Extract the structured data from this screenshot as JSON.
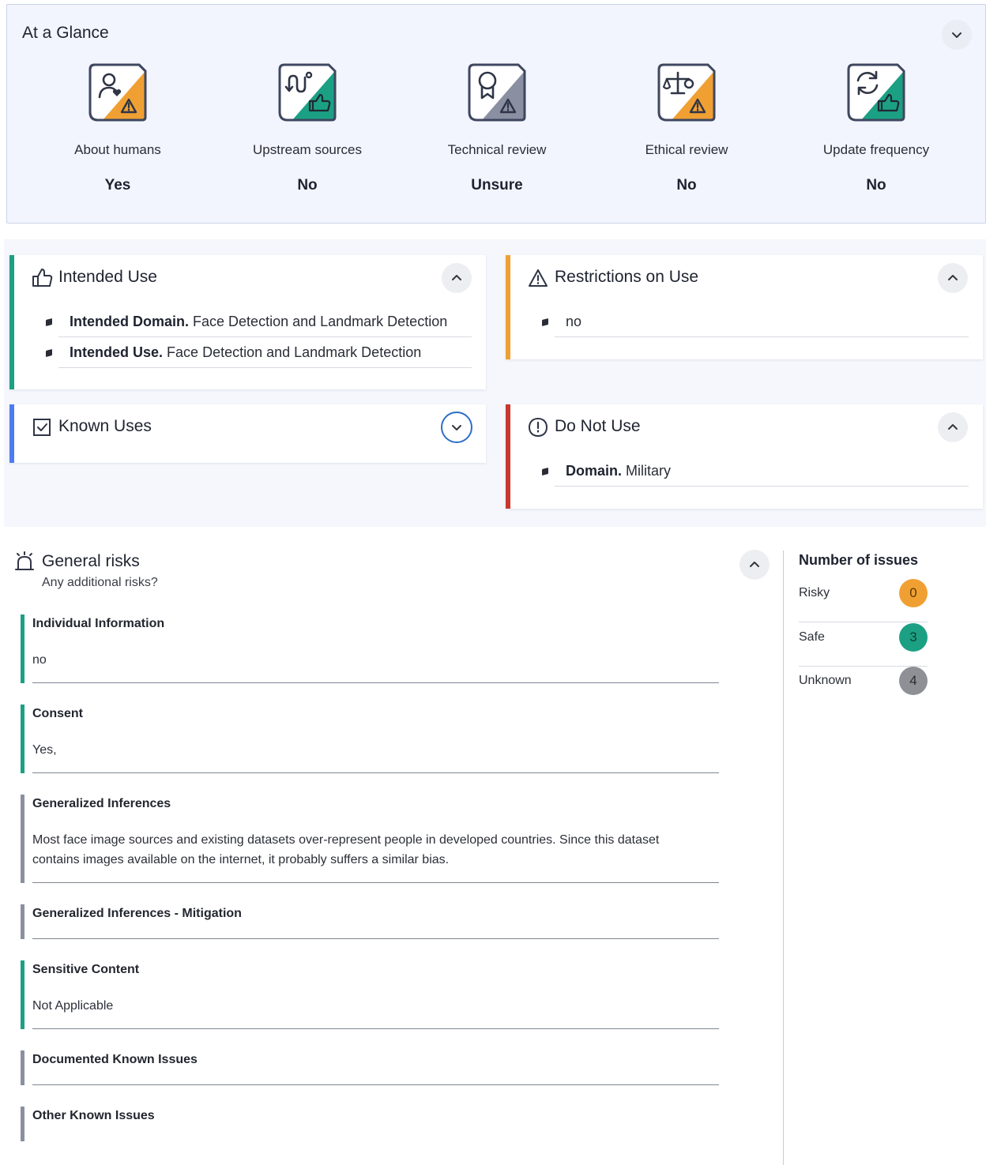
{
  "glance": {
    "title": "At a Glance",
    "collapse_icon": "chevron-down-icon",
    "items": [
      {
        "label": "About humans",
        "value": "Yes",
        "icon": "person-heart-icon",
        "status": "warning",
        "status_color": "#f0a033"
      },
      {
        "label": "Upstream sources",
        "value": "No",
        "icon": "route-icon",
        "status": "thumbs-up",
        "status_color": "#1ca084"
      },
      {
        "label": "Technical review",
        "value": "Unsure",
        "icon": "award-icon",
        "status": "warning",
        "status_color": "#8a90a2"
      },
      {
        "label": "Ethical review",
        "value": "No",
        "icon": "scale-icon",
        "status": "warning",
        "status_color": "#f0a033"
      },
      {
        "label": "Update frequency",
        "value": "No",
        "icon": "refresh-icon",
        "status": "thumbs-up",
        "status_color": "#1ca084"
      }
    ]
  },
  "cards": {
    "intended_use": {
      "title": "Intended Use",
      "icon": "thumbs-up-icon",
      "accent": "#1ca084",
      "items": [
        {
          "label": "Intended Domain.",
          "text": "Face Detection and Landmark Detection"
        },
        {
          "label": "Intended Use.",
          "text": "Face Detection and Landmark Detection"
        }
      ]
    },
    "restrictions": {
      "title": "Restrictions on Use",
      "icon": "warning-icon",
      "accent": "#f0a033",
      "items": [
        {
          "label": "",
          "text": "no"
        }
      ]
    },
    "known_uses": {
      "title": "Known Uses",
      "icon": "checkbox-icon",
      "accent": "#4d7cf2"
    },
    "do_not_use": {
      "title": "Do Not Use",
      "icon": "alert-circle-icon",
      "accent": "#c8372f",
      "items": [
        {
          "label": "Domain.",
          "text": "Military"
        }
      ]
    }
  },
  "general_risks": {
    "title": "General risks",
    "subtitle": "Any additional risks?",
    "icon": "alarm-icon",
    "items": [
      {
        "title": "Individual Information",
        "text": "no",
        "status_color": "#1ca084"
      },
      {
        "title": "Consent",
        "text": "Yes,",
        "status_color": "#1ca084"
      },
      {
        "title": "Generalized Inferences",
        "text": "Most face image sources and existing datasets over-represent people in developed countries. Since this dataset contains images available on the internet, it probably suffers a similar bias.",
        "status_color": "#8a90a2"
      },
      {
        "title": "Generalized Inferences - Mitigation",
        "text": "",
        "status_color": "#8a90a2"
      },
      {
        "title": "Sensitive Content",
        "text": "Not Applicable",
        "status_color": "#1ca084"
      },
      {
        "title": "Documented Known Issues",
        "text": "",
        "status_color": "#8a90a2"
      },
      {
        "title": "Other Known Issues",
        "text": "",
        "status_color": "#8a90a2"
      }
    ]
  },
  "issues": {
    "title": "Number of issues",
    "rows": [
      {
        "label": "Risky",
        "count": "0",
        "color": "#f0a033"
      },
      {
        "label": "Safe",
        "count": "3",
        "color": "#1ca084"
      },
      {
        "label": "Unknown",
        "count": "4",
        "color": "#8e9096"
      }
    ]
  }
}
